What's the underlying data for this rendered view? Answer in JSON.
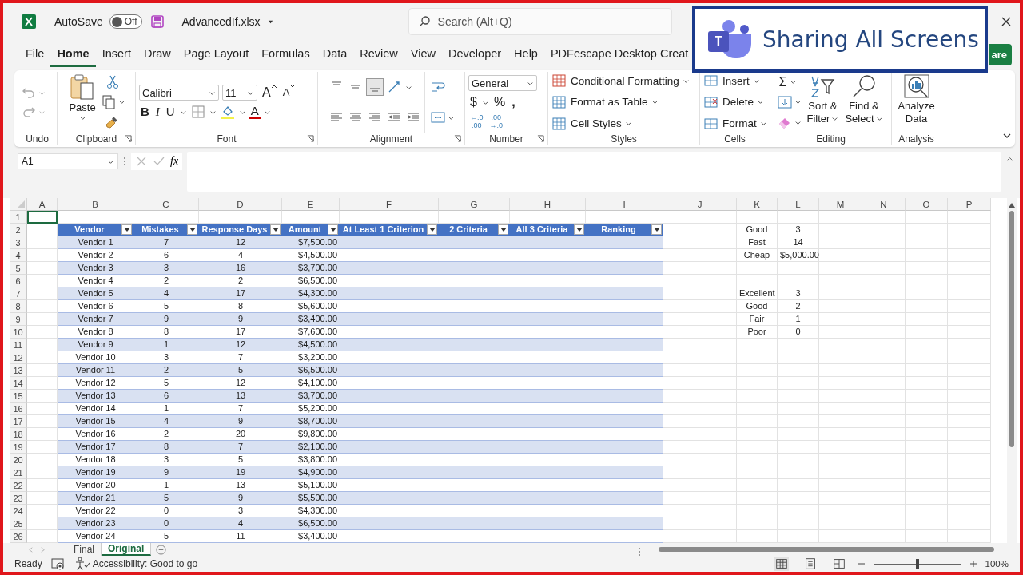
{
  "title_bar": {
    "autosave_label": "AutoSave",
    "autosave_toggle": {
      "label": "Off",
      "on": false
    },
    "filename": "AdvancedIf.xlsx",
    "search_placeholder": "Search (Alt+Q)"
  },
  "menu_tabs": [
    {
      "label": "File",
      "selected": false
    },
    {
      "label": "Home",
      "selected": true
    },
    {
      "label": "Insert",
      "selected": false
    },
    {
      "label": "Draw",
      "selected": false
    },
    {
      "label": "Page Layout",
      "selected": false
    },
    {
      "label": "Formulas",
      "selected": false
    },
    {
      "label": "Data",
      "selected": false
    },
    {
      "label": "Review",
      "selected": false
    },
    {
      "label": "View",
      "selected": false
    },
    {
      "label": "Developer",
      "selected": false
    },
    {
      "label": "Help",
      "selected": false
    },
    {
      "label": "PDFescape Desktop Creat",
      "selected": false
    }
  ],
  "share_button": "are",
  "overlay": {
    "text": "Sharing All Screens",
    "logo_letter": "T"
  },
  "ribbon": {
    "undo": {
      "label": "Undo"
    },
    "clipboard": {
      "label": "Clipboard",
      "paste": "Paste"
    },
    "font": {
      "label": "Font",
      "font_name": "Calibri",
      "font_size": "11",
      "grow": "A",
      "shrink": "A",
      "bold": "B",
      "italic": "I",
      "underline": "U",
      "font_color": "A"
    },
    "alignment": {
      "label": "Alignment"
    },
    "number": {
      "label": "Number",
      "format": "General",
      "currency": "$",
      "percent": "%",
      "comma": ",",
      "increase_decimal": [
        "←.0",
        ".00"
      ],
      "decrease_decimal": [
        ".00",
        "→.0"
      ]
    },
    "styles": {
      "label": "Styles",
      "items": [
        "Conditional Formatting",
        "Format as Table",
        "Cell Styles"
      ]
    },
    "cells": {
      "label": "Cells",
      "items": [
        "Insert",
        "Delete",
        "Format"
      ]
    },
    "editing": {
      "label": "Editing",
      "autosum": "Σ",
      "sort": [
        "Sort &",
        "Filter"
      ],
      "find": [
        "Find &",
        "Select"
      ]
    },
    "analysis": {
      "label": "Analysis",
      "analyze": [
        "Analyze",
        "Data"
      ]
    }
  },
  "formula_bar": {
    "name_box": "A1",
    "fx": "fx"
  },
  "sheet": {
    "columns": [
      "A",
      "B",
      "C",
      "D",
      "E",
      "F",
      "G",
      "H",
      "I",
      "J",
      "K",
      "L",
      "M",
      "N",
      "O",
      "P"
    ],
    "rows": [
      "1",
      "2",
      "3",
      "4",
      "5",
      "6",
      "7",
      "8",
      "9",
      "10",
      "11",
      "12",
      "13",
      "14",
      "15",
      "16",
      "17",
      "18",
      "19",
      "20",
      "21",
      "22",
      "23",
      "24",
      "25",
      "26"
    ],
    "a1_selected": true
  },
  "table": {
    "columns": [
      "Vendor",
      "Mistakes",
      "Response Days",
      "Amount",
      "At Least 1 Criterion",
      "2 Criteria",
      "All 3 Criteria",
      "Ranking"
    ],
    "rows": [
      [
        "Vendor 1",
        "7",
        "12",
        "$7,500.00"
      ],
      [
        "Vendor 2",
        "6",
        "4",
        "$4,500.00"
      ],
      [
        "Vendor 3",
        "3",
        "16",
        "$3,700.00"
      ],
      [
        "Vendor 4",
        "2",
        "2",
        "$6,500.00"
      ],
      [
        "Vendor 5",
        "4",
        "17",
        "$4,300.00"
      ],
      [
        "Vendor 6",
        "5",
        "8",
        "$5,600.00"
      ],
      [
        "Vendor 7",
        "9",
        "9",
        "$3,400.00"
      ],
      [
        "Vendor 8",
        "8",
        "17",
        "$7,600.00"
      ],
      [
        "Vendor 9",
        "1",
        "12",
        "$4,500.00"
      ],
      [
        "Vendor 10",
        "3",
        "7",
        "$3,200.00"
      ],
      [
        "Vendor 11",
        "2",
        "5",
        "$6,500.00"
      ],
      [
        "Vendor 12",
        "5",
        "12",
        "$4,100.00"
      ],
      [
        "Vendor 13",
        "6",
        "13",
        "$3,700.00"
      ],
      [
        "Vendor 14",
        "1",
        "7",
        "$5,200.00"
      ],
      [
        "Vendor 15",
        "4",
        "9",
        "$8,700.00"
      ],
      [
        "Vendor 16",
        "2",
        "20",
        "$9,800.00"
      ],
      [
        "Vendor 17",
        "8",
        "7",
        "$2,100.00"
      ],
      [
        "Vendor 18",
        "3",
        "5",
        "$3,800.00"
      ],
      [
        "Vendor 19",
        "9",
        "19",
        "$4,900.00"
      ],
      [
        "Vendor 20",
        "1",
        "13",
        "$5,100.00"
      ],
      [
        "Vendor 21",
        "5",
        "9",
        "$5,500.00"
      ],
      [
        "Vendor 22",
        "0",
        "3",
        "$4,300.00"
      ],
      [
        "Vendor 23",
        "0",
        "4",
        "$6,500.00"
      ],
      [
        "Vendor 24",
        "5",
        "11",
        "$3,400.00"
      ]
    ]
  },
  "side_tables": [
    [
      {
        "label": "Good",
        "value": "3"
      },
      {
        "label": "Fast",
        "value": "14"
      },
      {
        "label": "Cheap",
        "value": "$5,000.00"
      }
    ],
    [
      {
        "label": "Excellent",
        "value": "3"
      },
      {
        "label": "Good",
        "value": "2"
      },
      {
        "label": "Fair",
        "value": "1"
      },
      {
        "label": "Poor",
        "value": "0"
      }
    ]
  ],
  "sheet_tabs": [
    {
      "label": "Final",
      "selected": false
    },
    {
      "label": "Original",
      "selected": true
    }
  ],
  "status_bar": {
    "ready": "Ready",
    "accessibility": "Accessibility: Good to go",
    "views": [
      {
        "kind": "normal",
        "selected": true
      },
      {
        "kind": "page_layout",
        "selected": false
      },
      {
        "kind": "page_break",
        "selected": false
      }
    ],
    "zoom": {
      "level": 0.5,
      "reading": "100%"
    }
  }
}
